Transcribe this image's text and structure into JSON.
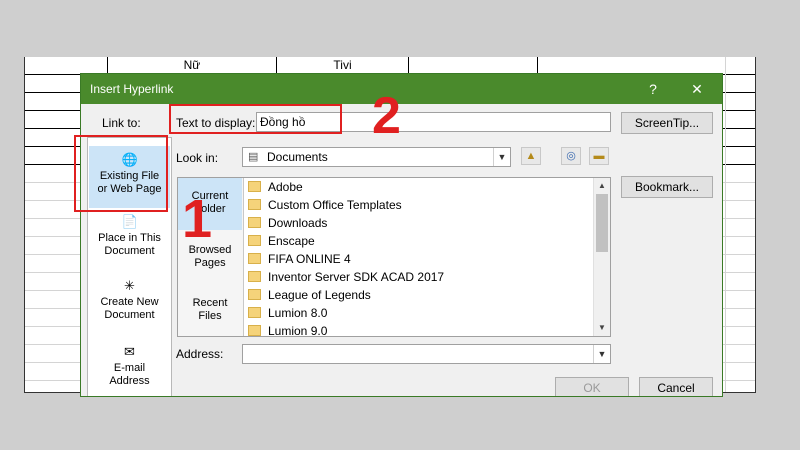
{
  "sheet": {
    "col_headers": [
      "Nữ",
      "Tivi"
    ]
  },
  "dialog": {
    "title": "Insert Hyperlink",
    "help": "?",
    "close": "✕",
    "link_to_label": "Link to:",
    "text_to_display_label": "Text to display:",
    "text_to_display_value": "Đồng hồ",
    "screentip_button": "ScreenTip...",
    "look_in_label": "Look in:",
    "look_in_value": "Documents",
    "bookmark_button": "Bookmark...",
    "address_label": "Address:",
    "address_value": "",
    "ok_button": "OK",
    "cancel_button": "Cancel",
    "link_targets": [
      {
        "line1": "Existing File",
        "line2": "or Web Page"
      },
      {
        "line1": "Place in This",
        "line2": "Document"
      },
      {
        "line1": "Create New",
        "line2": "Document"
      },
      {
        "line1": "E-mail",
        "line2": "Address"
      }
    ],
    "look_locations": [
      {
        "line1": "Current",
        "line2": "Folder"
      },
      {
        "line1": "Browsed",
        "line2": "Pages"
      },
      {
        "line1": "Recent",
        "line2": "Files"
      }
    ],
    "files": [
      "Adobe",
      "Custom Office Templates",
      "Downloads",
      "Enscape",
      "FIFA ONLINE 4",
      "Inventor Server SDK ACAD 2017",
      "League of Legends",
      "Lumion 8.0",
      "Lumion 9.0"
    ]
  },
  "annotations": {
    "step1": "1",
    "step2": "2"
  },
  "colors": {
    "titlebar": "#4a8a2c",
    "selection": "#cce4f7",
    "annotation": "#e02020"
  }
}
